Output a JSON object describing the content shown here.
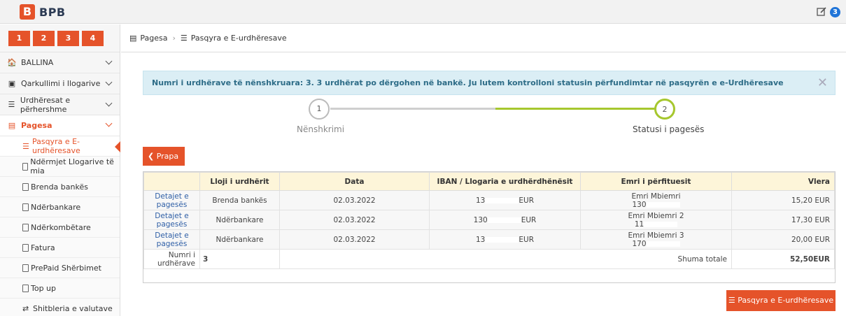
{
  "brand": {
    "name": "BPB",
    "mark": "B"
  },
  "topbar": {
    "badge": "3"
  },
  "sidebar": {
    "steps": [
      "1",
      "2",
      "3",
      "4"
    ],
    "menu": [
      {
        "label": "BALLINA"
      },
      {
        "label": "Qarkullimi i llogarive"
      },
      {
        "label": "Urdhëresat e përhershme"
      },
      {
        "label": "Pagesa"
      }
    ],
    "sub": [
      {
        "label": "Pasqyra e E-urdhëresave"
      },
      {
        "label": "Ndërmjet Llogarive të mia"
      },
      {
        "label": "Brenda bankës"
      },
      {
        "label": "Ndërbankare"
      },
      {
        "label": "Ndërkombëtare"
      },
      {
        "label": "Fatura"
      },
      {
        "label": "PrePaid Shërbimet"
      },
      {
        "label": "Top up"
      },
      {
        "label": "Shitbleria e valutave"
      }
    ]
  },
  "breadcrumb": {
    "first": "Pagesa",
    "second": "Pasqyra e E-urdhëresave"
  },
  "alert": {
    "text": "Numri i urdhërave të nënshkruara: 3. 3 urdhërat po dërgohen në bankë. Ju lutem kontrolloni statusin përfundimtar në pasqyrën e e-Urdhëresave"
  },
  "progress": {
    "steps": [
      {
        "num": "1",
        "label": "Nënshkrimi"
      },
      {
        "num": "2",
        "label": "Statusi i pagesës"
      }
    ],
    "accent": "#a6c72e"
  },
  "back_button": "Prapa",
  "table": {
    "headers": [
      "",
      "Lloji i urdhërit",
      "Data",
      "IBAN / Llogaria e urdhërdhënësit",
      "Emri i përfituesit",
      "Vlera"
    ],
    "rows": [
      {
        "link1": "Detajet e",
        "link2": "pagesës",
        "type": "Brenda bankës",
        "date": "02.03.2022",
        "iban_a": "13",
        "iban_b": "EUR",
        "name": "Emri Mbiemri",
        "acct": "130",
        "value": "15,20 EUR"
      },
      {
        "link1": "Detajet e",
        "link2": "pagesës",
        "type": "Ndërbankare",
        "date": "02.03.2022",
        "iban_a": "130",
        "iban_b": "EUR",
        "name": "Emri Mbiemri 2",
        "acct": "11",
        "value": "17,30 EUR"
      },
      {
        "link1": "Detajet e",
        "link2": "pagesës",
        "type": "Ndërbankare",
        "date": "02.03.2022",
        "iban_a": "13",
        "iban_b": "EUR",
        "name": "Emri Mbiemri 3",
        "acct": "170",
        "value": "20,00 EUR"
      }
    ],
    "footer": {
      "count_label1": "Numri i",
      "count_label2": "urdhërave",
      "count": "3",
      "total_label": "Shuma totale",
      "total": "52,50EUR"
    }
  },
  "bottom_button": "Pasqyra e E-urdhëresave",
  "colors": {
    "accent": "#e5532a",
    "alert_bg": "#dbeef5",
    "header_bg": "#fdf5d9"
  }
}
